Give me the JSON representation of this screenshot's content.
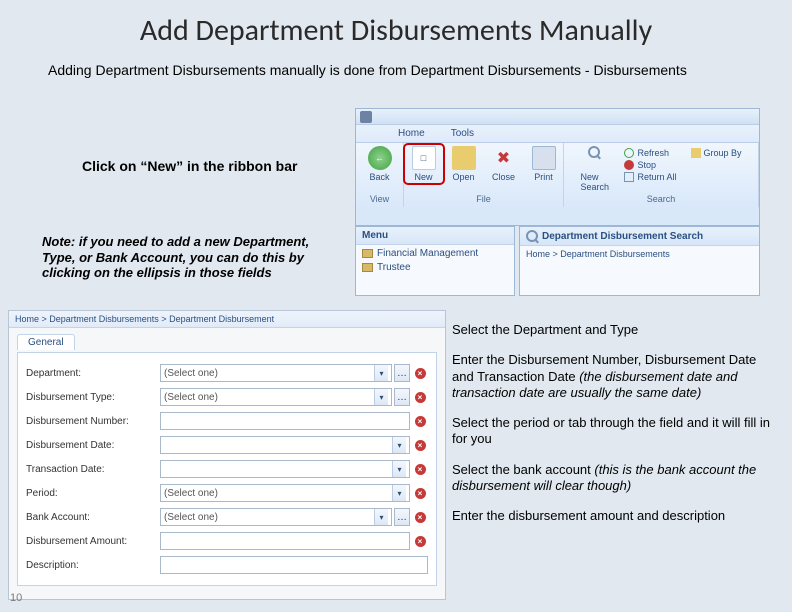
{
  "title": "Add Department Disbursements Manually",
  "intro": "Adding Department Disbursements manually is done from Department Disbursements - Disbursements",
  "click_new": "Click on “New” in the ribbon bar",
  "note": "Note: if you need to add a new Department, Type, or Bank Account, you can do this by clicking on the ellipsis in those fields",
  "ribbon": {
    "tabs": {
      "home": "Home",
      "tools": "Tools"
    },
    "buttons": {
      "back": "Back",
      "new": "New",
      "open": "Open",
      "close": "Close",
      "print": "Print",
      "new_search": "New Search"
    },
    "groups": {
      "view": "View",
      "file": "File",
      "search": "Search"
    },
    "search_items": {
      "refresh": "Refresh",
      "stop": "Stop",
      "return_all": "Return All",
      "group_by": "Group By"
    }
  },
  "panes": {
    "menu_title": "Menu",
    "menu_items": [
      "Financial Management",
      "Trustee"
    ],
    "search_title": "Department Disbursement Search",
    "search_crumb": "Home  >  Department Disbursements"
  },
  "form": {
    "crumb": "Home  >  Department Disbursements  >  Department Disbursement",
    "tab": "General",
    "fields": {
      "department": {
        "label": "Department:",
        "value": "(Select one)"
      },
      "type": {
        "label": "Disbursement Type:",
        "value": "(Select one)"
      },
      "number": {
        "label": "Disbursement Number:",
        "value": ""
      },
      "date": {
        "label": "Disbursement Date:",
        "value": ""
      },
      "txn_date": {
        "label": "Transaction Date:",
        "value": ""
      },
      "period": {
        "label": "Period:",
        "value": "(Select one)"
      },
      "bank": {
        "label": "Bank Account:",
        "value": "(Select one)"
      },
      "amount": {
        "label": "Disbursement Amount:",
        "value": ""
      },
      "desc": {
        "label": "Description:",
        "value": ""
      }
    }
  },
  "instructions": {
    "i1": "Select the Department and Type",
    "i2a": "Enter the Disbursement Number, Disbursement Date and Transaction Date ",
    "i2b": "(the disbursement date and transaction date are usually the same date)",
    "i3": "Select the period or tab through the field and it will fill in for you",
    "i4a": "Select the bank account ",
    "i4b": "(this is the bank account the disbursement will clear though)",
    "i5": "Enter the disbursement amount and description"
  },
  "page_number": "10"
}
